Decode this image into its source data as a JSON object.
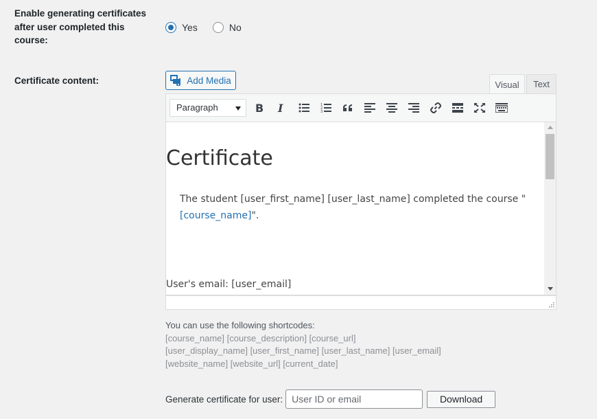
{
  "enable_field": {
    "label": "Enable generating certificates after user completed this course:",
    "options": [
      {
        "label": "Yes",
        "checked": true
      },
      {
        "label": "No",
        "checked": false
      }
    ]
  },
  "content_field": {
    "label": "Certificate content:"
  },
  "editor": {
    "add_media_label": "Add Media",
    "tabs": {
      "visual": "Visual",
      "text": "Text"
    },
    "active_tab": "Visual",
    "format_select": "Paragraph",
    "toolbar_icons": [
      "bold-icon",
      "italic-icon",
      "bullet-list-icon",
      "numbered-list-icon",
      "blockquote-icon",
      "align-left-icon",
      "align-center-icon",
      "align-right-icon",
      "link-icon",
      "read-more-icon",
      "fullscreen-icon",
      "toolbar-toggle-icon"
    ],
    "content": {
      "title": "Certificate",
      "line1_before": "The student [user_first_name] [user_last_name] completed the course \"",
      "course_link": "[course_name]",
      "line1_after": "\".",
      "email_line": "User's email: [user_email]"
    }
  },
  "shortcodes": {
    "intro": "You can use the following shortcodes:",
    "line1": "[course_name] [course_description] [course_url]",
    "line2": "[user_display_name] [user_first_name] [user_last_name] [user_email]",
    "line3": "[website_name] [website_url] [current_date]"
  },
  "generate": {
    "label": "Generate certificate for user:",
    "placeholder": "User ID or email",
    "value": "",
    "button_label": "Download"
  },
  "colors": {
    "accent": "#2271b1",
    "background": "#f1f1f1"
  }
}
